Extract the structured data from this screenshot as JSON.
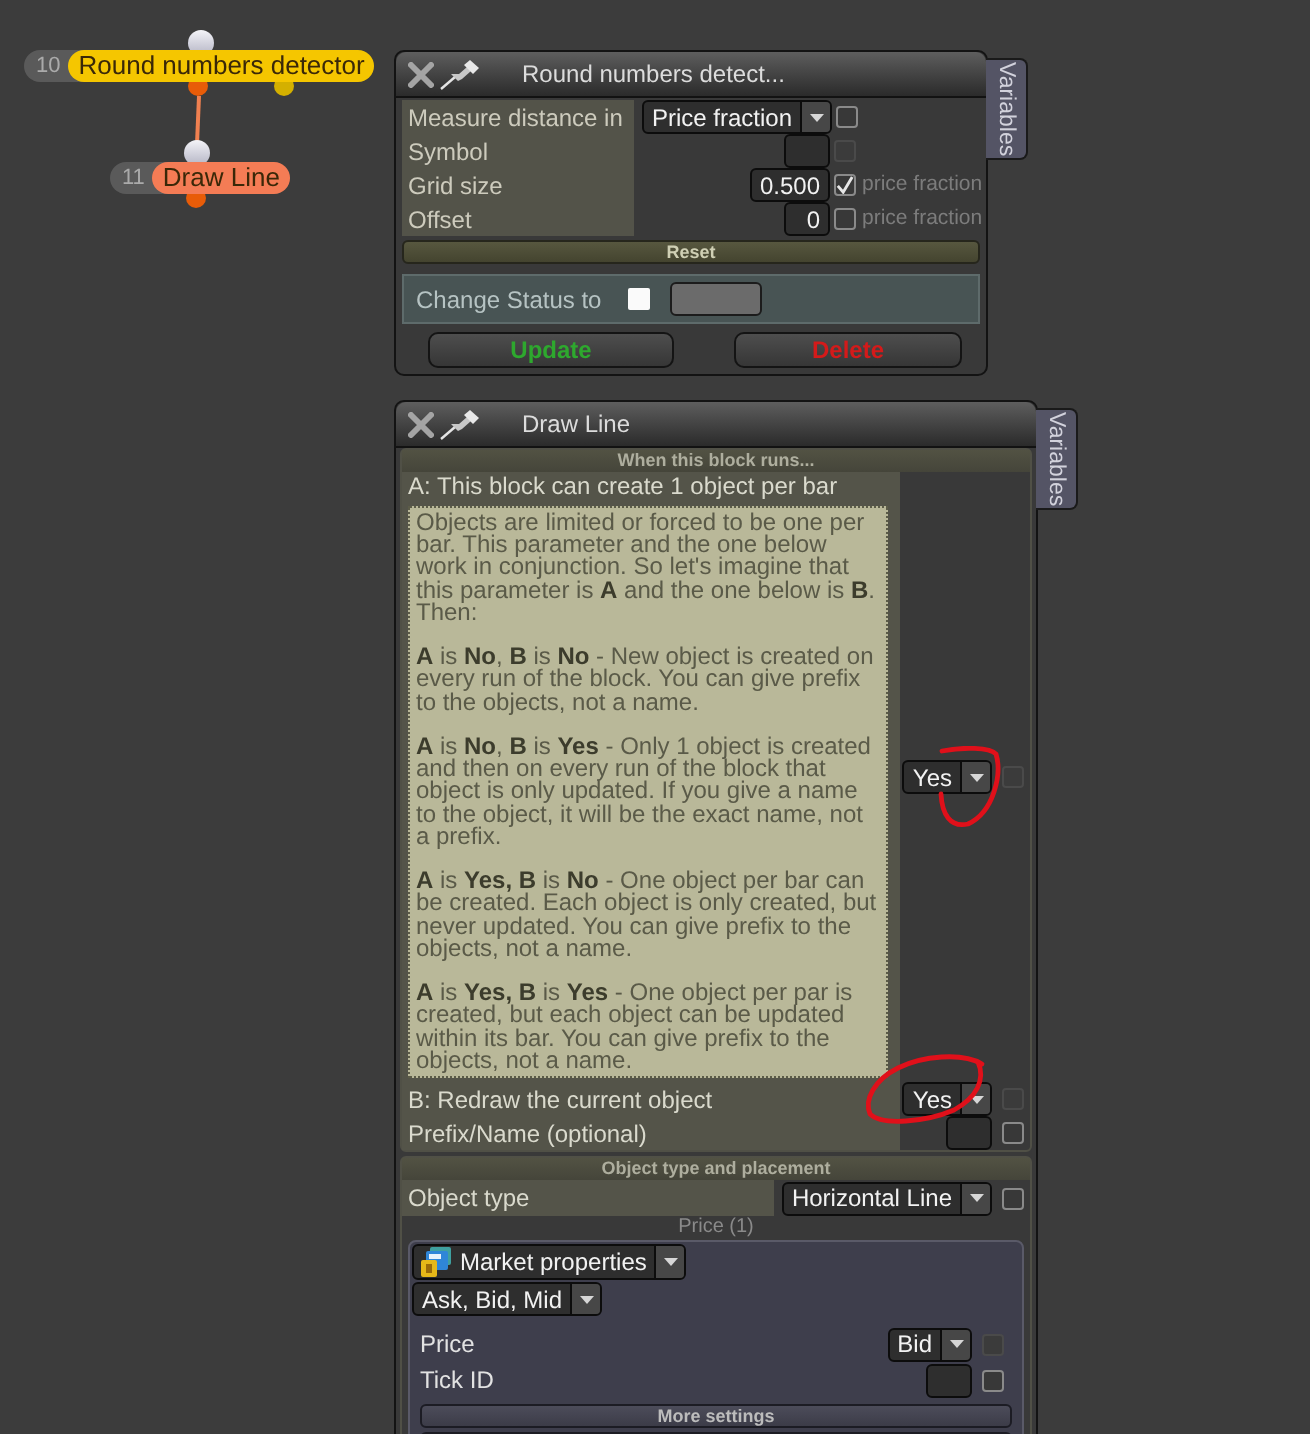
{
  "graph": {
    "nodes": [
      {
        "number": "10",
        "label": "Round numbers detector",
        "color": "#f5c600"
      },
      {
        "number": "11",
        "label": "Draw Line",
        "color": "#f47c55"
      }
    ]
  },
  "panels": [
    {
      "title": "Round numbers detect...",
      "side_tab": "Variables",
      "rows": [
        {
          "kind": "dropdown",
          "label": "Measure distance in",
          "value": "Price fraction",
          "checked": false,
          "checkbox_disabled": false
        },
        {
          "kind": "field",
          "label": "Symbol",
          "checked": false,
          "checkbox_disabled": true
        },
        {
          "kind": "field",
          "label": "Grid size",
          "value": "0.500",
          "checked": true,
          "checkbox_disabled": false,
          "unit": "price fraction"
        },
        {
          "kind": "field",
          "label": "Offset",
          "value": "0",
          "checked": false,
          "checkbox_disabled": false,
          "unit": "price fraction"
        }
      ],
      "reset_button": "Reset",
      "change_status": {
        "label": "Change Status to",
        "checked": false
      },
      "buttons": [
        {
          "label": "Update",
          "kind": "update"
        },
        {
          "label": "Delete",
          "kind": "delete"
        }
      ]
    },
    {
      "title": "Draw Line",
      "side_tab": "Variables",
      "sections": [
        {
          "header": "When this block runs...",
          "rows": [
            {
              "kind": "help_dropdown",
              "label": "A: This block can create 1 object per bar",
              "help": [
                "Objects are limited or forced to be one per bar. This parameter and the one below work in conjunction. So let's imagine that this parameter is **A** and the one below is **B**. Then:",
                "**A** is **No**, **B** is **No** - New object is created on every run of the block. You can give prefix to the objects, not a name.",
                "**A** is **No**, **B** is **Yes** - Only 1 object is created and then on every run of the block that object is only updated. If you give a name to the object, it will be the exact name, not a prefix.",
                "**A** is **Yes, B** is **No** - One object per bar can be created. Each object is only created, but never updated. You can give prefix to the objects, not a name.",
                "**A** is **Yes, B** is **Yes** - One object per par is created, but each object can be updated within its bar. You can give prefix to the objects, not a name."
              ],
              "value": "Yes",
              "checked": false,
              "checkbox_disabled": true,
              "circled": true
            },
            {
              "kind": "dropdown",
              "label": "B: Redraw the current object",
              "value": "Yes",
              "checked": false,
              "checkbox_disabled": true,
              "circled": true
            },
            {
              "kind": "field",
              "label": "Prefix/Name (optional)",
              "checked": false,
              "checkbox_disabled": false,
              "circled": false
            }
          ]
        },
        {
          "header": "Object type and placement",
          "rows": [
            {
              "kind": "dropdown",
              "label": "Object type",
              "value": "Horizontal Line",
              "checked": false,
              "checkbox_disabled": false,
              "circled": false
            },
            {
              "kind": "group",
              "caption": "Price (1)",
              "source": "Market properties",
              "subsource": "Ask, Bid, Mid",
              "rows": [
                {
                  "kind": "dropdown",
                  "label": "Price",
                  "value": "Bid",
                  "checked": false,
                  "checkbox_disabled": true
                },
                {
                  "kind": "field",
                  "label": "Tick ID",
                  "checked": false,
                  "checkbox_disabled": false
                }
              ],
              "more_button": "More settings"
            }
          ]
        }
      ]
    }
  ]
}
